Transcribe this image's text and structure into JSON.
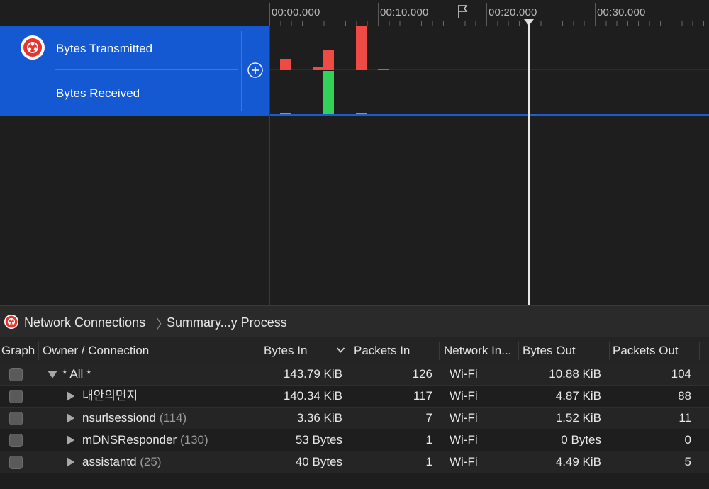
{
  "timeline": {
    "ticks": [
      "00:00.000",
      "00:10.000",
      "00:20.000",
      "00:30.000"
    ]
  },
  "instrument": {
    "tracks": [
      "Bytes Transmitted",
      "Bytes Received"
    ],
    "icon": "network-icon",
    "add_icon": "plus-circle-icon"
  },
  "graph": {
    "colors": {
      "transmitted": "#f04a45",
      "received": "#32d25a"
    }
  },
  "breadcrumb": {
    "items": [
      "Network Connections",
      "Summary...y Process"
    ],
    "icon": "network-icon"
  },
  "table": {
    "columns": [
      "Graph",
      "Owner / Connection",
      "Bytes In",
      "Packets In",
      "Network In...",
      "Bytes Out",
      "Packets Out"
    ],
    "sorted_column": "Bytes In",
    "rows": [
      {
        "owner": "* All *",
        "pid": "",
        "bytes_in": "143.79 KiB",
        "packets_in": "126",
        "network": "Wi-Fi",
        "bytes_out": "10.88 KiB",
        "packets_out": "104",
        "expanded": "true"
      },
      {
        "owner": "내안의먼지",
        "pid": "",
        "bytes_in": "140.34 KiB",
        "packets_in": "117",
        "network": "Wi-Fi",
        "bytes_out": "4.87 KiB",
        "packets_out": "88",
        "expanded": "false"
      },
      {
        "owner": "nsurlsessiond",
        "pid": "(114)",
        "bytes_in": "3.36 KiB",
        "packets_in": "7",
        "network": "Wi-Fi",
        "bytes_out": "1.52 KiB",
        "packets_out": "11",
        "expanded": "false"
      },
      {
        "owner": "mDNSResponder",
        "pid": "(130)",
        "bytes_in": "53 Bytes",
        "packets_in": "1",
        "network": "Wi-Fi",
        "bytes_out": "0 Bytes",
        "packets_out": "0",
        "expanded": "false"
      },
      {
        "owner": "assistantd",
        "pid": "(25)",
        "bytes_in": "40 Bytes",
        "packets_in": "1",
        "network": "Wi-Fi",
        "bytes_out": "4.49 KiB",
        "packets_out": "5",
        "expanded": "false"
      }
    ]
  }
}
